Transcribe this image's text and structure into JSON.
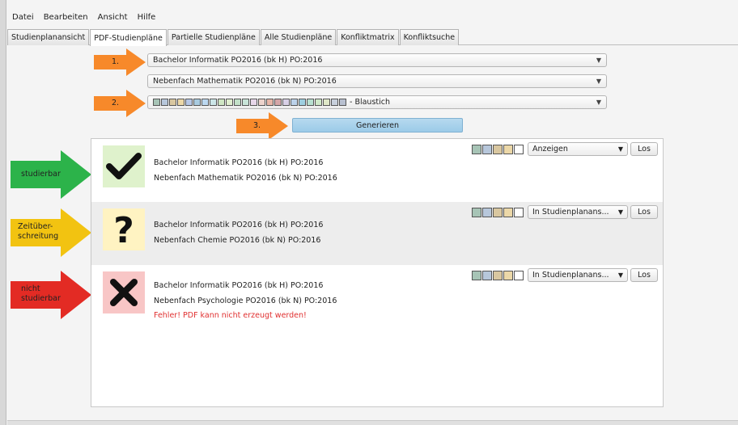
{
  "menu": [
    "Datei",
    "Bearbeiten",
    "Ansicht",
    "Hilfe"
  ],
  "tabs": [
    {
      "label": "Studienplanansicht",
      "active": false
    },
    {
      "label": "PDF-Studienpläne",
      "active": true
    },
    {
      "label": "Partielle Studienpläne",
      "active": false
    },
    {
      "label": "Alle Studienpläne",
      "active": false
    },
    {
      "label": "Konfliktmatrix",
      "active": false
    },
    {
      "label": "Konfliktsuche",
      "active": false
    }
  ],
  "form": {
    "major_select": "Bachelor Informatik PO2016 (bk H) PO:2016",
    "minor_select": "Nebenfach Mathematik PO2016 (bk N) PO:2016",
    "color_scheme_label": "- Blaustich",
    "color_scheme_swatches": [
      "#a7c4b6",
      "#b7c7db",
      "#d9c7a0",
      "#ecd8a8",
      "#b6c7e6",
      "#a9cbe0",
      "#bcd8f0",
      "#cce6e8",
      "#cfe6c4",
      "#dfeecf",
      "#c2e0c8",
      "#c8e4d8",
      "#e7d7ea",
      "#ecd3cc",
      "#e6b6a8",
      "#d4a6a8",
      "#d8d0e6",
      "#bcd2ea",
      "#9ecfe0",
      "#b8e0d0",
      "#cfe8c8",
      "#dfe8c8",
      "#c8d0dc",
      "#b8c0d0"
    ],
    "generate_label": "Generieren"
  },
  "steps": {
    "s1": "1.",
    "s2": "2.",
    "s3": "3."
  },
  "legend": {
    "studierbar": "studierbar",
    "zeit_line1": "Zeitüber-",
    "zeit_line2": "schreitung",
    "nicht_line1": "nicht",
    "nicht_line2": "studierbar"
  },
  "colors": {
    "green": "#2cb34a",
    "yellow": "#f2c311",
    "red": "#e32b24",
    "orange": "#f7892a"
  },
  "row_swatches": [
    "#a7c4b6",
    "#b7c7db",
    "#d9c7a0",
    "#ecd8a8",
    "#ffffff"
  ],
  "results": [
    {
      "status": "studierbar",
      "icon": "check-icon",
      "line1": "Bachelor Informatik PO2016 (bk H) PO:2016",
      "line2": "Nebenfach Mathematik PO2016 (bk N) PO:2016",
      "action": "Anzeigen",
      "go": "Los",
      "error": ""
    },
    {
      "status": "zeitueberschreitung",
      "icon": "question-icon",
      "line1": "Bachelor Informatik PO2016 (bk H) PO:2016",
      "line2": "Nebenfach Chemie PO2016 (bk N) PO:2016",
      "action": "In Studienplanans...",
      "go": "Los",
      "error": ""
    },
    {
      "status": "nicht-studierbar",
      "icon": "cross-icon",
      "line1": "Bachelor Informatik PO2016 (bk H) PO:2016",
      "line2": "Nebenfach Psychologie PO2016 (bk N) PO:2016",
      "action": "In Studienplanans...",
      "go": "Los",
      "error": "Fehler! PDF kann nicht erzeugt werden!"
    }
  ]
}
